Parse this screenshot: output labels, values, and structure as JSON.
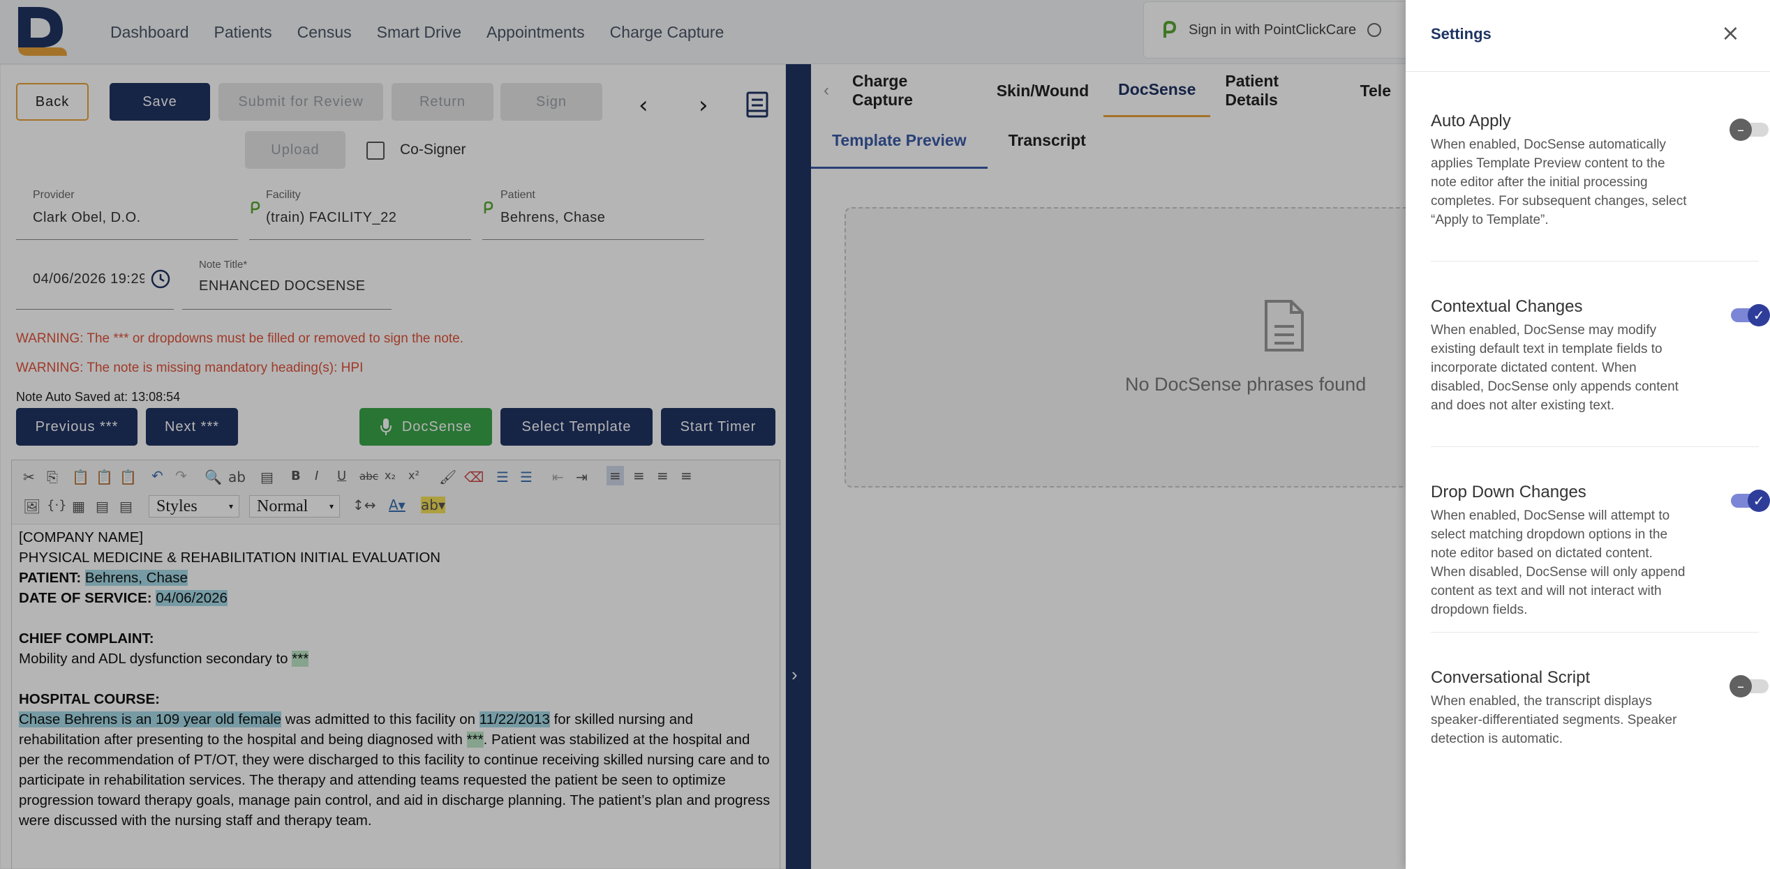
{
  "nav": {
    "items": [
      "Dashboard",
      "Patients",
      "Census",
      "Smart Drive",
      "Appointments",
      "Charge Capture"
    ],
    "pcc_label": "Sign in with PointClickCare"
  },
  "toolbar": {
    "back": "Back",
    "save": "Save",
    "submit": "Submit for Review",
    "return": "Return",
    "sign": "Sign",
    "upload": "Upload",
    "cosigner": "Co-Signer"
  },
  "fields": {
    "provider_label": "Provider",
    "provider": "Clark Obel, D.O.",
    "facility_label": "Facility",
    "facility": "(train) FACILITY_22",
    "patient_label": "Patient",
    "patient": "Behrens, Chase",
    "datetime": "04/06/2026 19:29",
    "note_title_label": "Note Title*",
    "note_title": "ENHANCED DOCSENSE"
  },
  "warnings": [
    "WARNING: The *** or dropdowns must be filled or removed to sign the note.",
    "WARNING: The note is missing mandatory heading(s): HPI"
  ],
  "autosave": "Note Auto Saved at: 13:08:54",
  "actions": {
    "previous": "Previous ***",
    "next": "Next ***",
    "docsense": "DocSense",
    "select_template": "Select Template",
    "start_timer": "Start Timer"
  },
  "editor": {
    "styles": "Styles",
    "format": "Normal",
    "company": "[COMPANY NAME]",
    "heading": "PHYSICAL MEDICINE & REHABILITATION INITIAL EVALUATION",
    "patient_label": "PATIENT:",
    "patient_value": "Behrens, Chase",
    "dos_label": "DATE OF SERVICE:",
    "dos_value": "04/06/2026",
    "cc_label": "CHIEF COMPLAINT:",
    "cc_text": "Mobility and ADL dysfunction secondary to ",
    "placeholder": "***",
    "hc_label": "HOSPITAL COURSE:",
    "hc_hl1": "Chase Behrens is an 109 year old female",
    "hc_t1": " was admitted to this facility on ",
    "hc_hl2": "11/22/2013",
    "hc_t2": " for skilled nursing and rehabilitation after presenting to the hospital and being diagnosed with ",
    "hc_t3": ". Patient was stabilized at the hospital and per the recommendation of PT/OT, they were discharged to this facility to continue receiving skilled nursing care and to participate in rehabilitation services. The therapy and attending teams requested the patient be seen to optimize progression toward therapy goals, manage pain control, and aid in discharge planning. The patient’s plan and progress were discussed with the nursing staff and therapy team."
  },
  "right": {
    "tabs": [
      "Charge Capture",
      "Skin/Wound",
      "DocSense",
      "Patient Details",
      "Tele"
    ],
    "active_tab": "DocSense",
    "subtabs": [
      "Template Preview",
      "Transcript"
    ],
    "empty": "No DocSense phrases found"
  },
  "settings": {
    "title": "Settings",
    "items": [
      {
        "name": "Auto Apply",
        "enabled": false,
        "desc": "When enabled, DocSense automatically applies Template Preview content to the note editor after the initial processing completes. For subsequent changes, select “Apply to Template”."
      },
      {
        "name": "Contextual Changes",
        "enabled": true,
        "desc": "When enabled, DocSense may modify existing default text in template fields to incorporate dictated content. When disabled, DocSense only appends content and does not alter existing text."
      },
      {
        "name": "Drop Down Changes",
        "enabled": true,
        "desc": "When enabled, DocSense will attempt to select matching dropdown options in the note editor based on dictated content. When disabled, DocSense will only append content as text and will not interact with dropdown fields."
      },
      {
        "name": "Conversational Script",
        "enabled": false,
        "desc": "When enabled, the transcript displays speaker-differentiated segments. Speaker detection is automatic."
      }
    ]
  },
  "colors": {
    "navy": "#1f3463",
    "accent": "#e8a23a",
    "green": "#3aa54a",
    "warning": "#e0523a",
    "toggle_on": "#2f3d9a"
  }
}
